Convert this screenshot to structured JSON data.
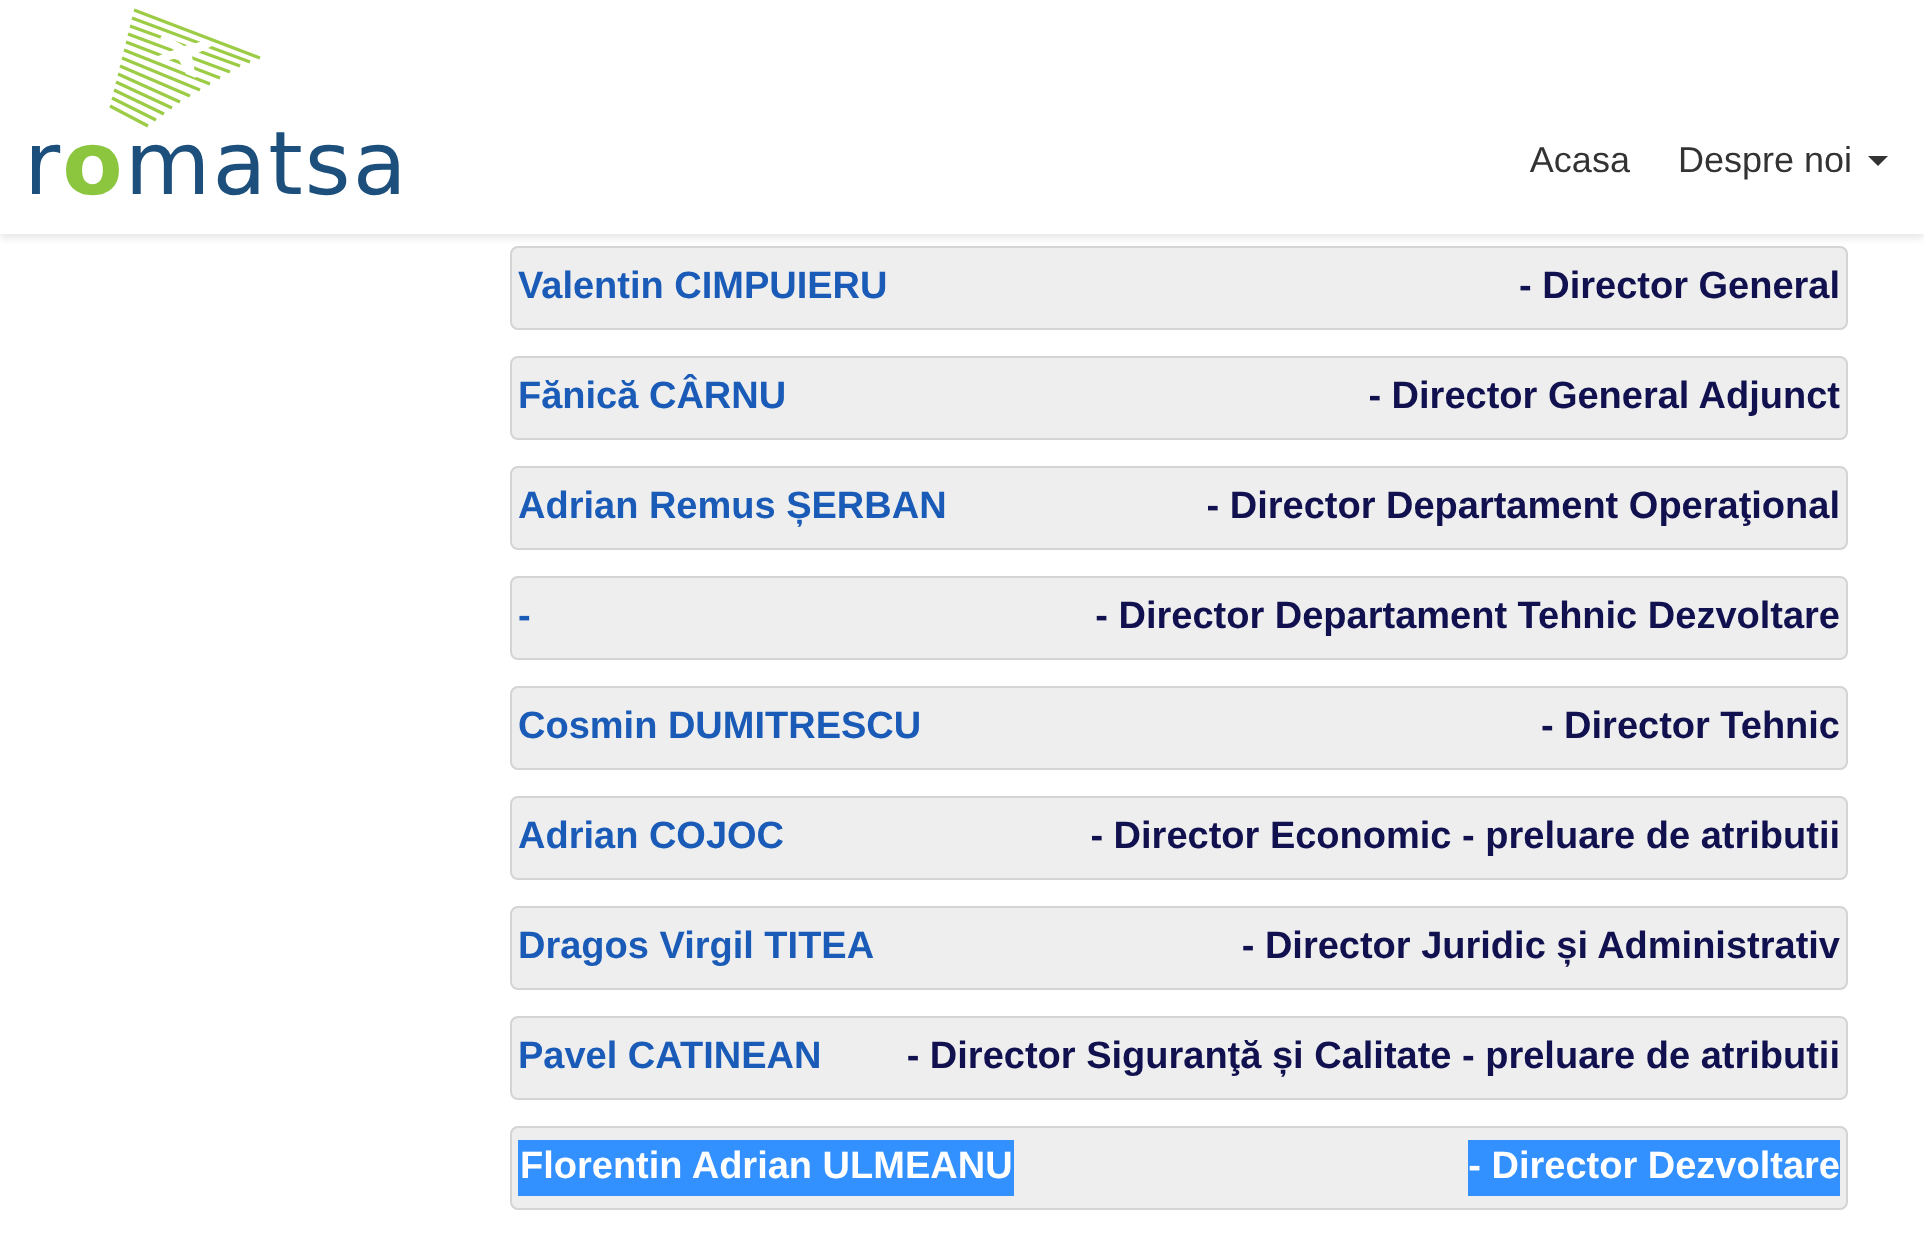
{
  "logo": {
    "parts": [
      {
        "text": "r",
        "accent": false
      },
      {
        "text": "o",
        "accent": true
      },
      {
        "text": "matsa",
        "accent": false
      }
    ]
  },
  "nav": [
    {
      "label": "Acasa",
      "dropdown": false
    },
    {
      "label": "Despre noi",
      "dropdown": true
    }
  ],
  "people": [
    {
      "name": "Valentin CIMPUIERU",
      "role": "- Director General",
      "highlighted": false
    },
    {
      "name": "Fănică CÂRNU",
      "role": "- Director General Adjunct",
      "highlighted": false
    },
    {
      "name": "Adrian Remus ȘERBAN",
      "role": "- Director Departament Operaţional",
      "highlighted": false
    },
    {
      "name": "-",
      "role": "- Director Departament Tehnic Dezvoltare",
      "highlighted": false
    },
    {
      "name": "Cosmin DUMITRESCU",
      "role": "- Director Tehnic",
      "highlighted": false
    },
    {
      "name": "Adrian COJOC",
      "role": "- Director Economic - preluare de atributii",
      "highlighted": false
    },
    {
      "name": "Dragos Virgil TITEA",
      "role": "- Director Juridic și Administrativ",
      "highlighted": false
    },
    {
      "name": "Pavel CATINEAN",
      "role": "- Director Siguranţă și Calitate - preluare de atributii",
      "highlighted": false
    },
    {
      "name": "Florentin Adrian ULMEANU",
      "role": "- Director Dezvoltare",
      "highlighted": true
    }
  ]
}
